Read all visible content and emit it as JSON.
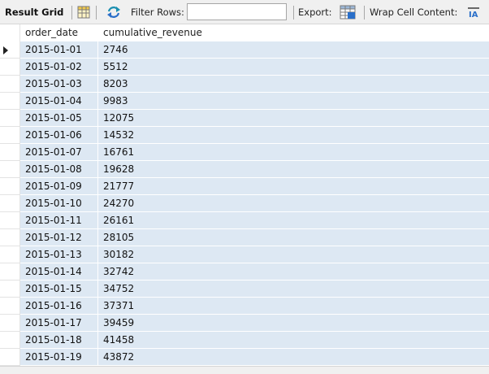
{
  "toolbar": {
    "title": "Result Grid",
    "filter_label": "Filter Rows:",
    "filter_value": "",
    "export_label": "Export:",
    "wrap_label": "Wrap Cell Content:",
    "icons": [
      "result-grid-icon",
      "refresh-icon",
      "export-icon",
      "wrap-icon"
    ]
  },
  "grid": {
    "columns": [
      "order_date",
      "cumulative_revenue"
    ],
    "current_row": 0,
    "rows": [
      [
        "2015-01-01",
        "2746"
      ],
      [
        "2015-01-02",
        "5512"
      ],
      [
        "2015-01-03",
        "8203"
      ],
      [
        "2015-01-04",
        "9983"
      ],
      [
        "2015-01-05",
        "12075"
      ],
      [
        "2015-01-06",
        "14532"
      ],
      [
        "2015-01-07",
        "16761"
      ],
      [
        "2015-01-08",
        "19628"
      ],
      [
        "2015-01-09",
        "21777"
      ],
      [
        "2015-01-10",
        "24270"
      ],
      [
        "2015-01-11",
        "26161"
      ],
      [
        "2015-01-12",
        "28105"
      ],
      [
        "2015-01-13",
        "30182"
      ],
      [
        "2015-01-14",
        "32742"
      ],
      [
        "2015-01-15",
        "34752"
      ],
      [
        "2015-01-16",
        "37371"
      ],
      [
        "2015-01-17",
        "39459"
      ],
      [
        "2015-01-18",
        "41458"
      ],
      [
        "2015-01-19",
        "43872"
      ]
    ]
  },
  "colors": {
    "row_bg": "#dde8f3",
    "toolbar_bg": "#f0f0f0",
    "icon_blue": "#2a6fc9",
    "icon_teal": "#1a8fb0"
  }
}
